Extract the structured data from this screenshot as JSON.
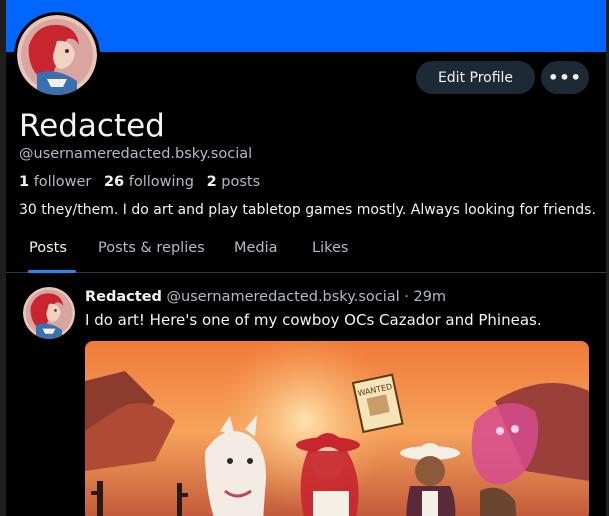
{
  "colors": {
    "banner": "#0066ff",
    "accent": "#208bfe",
    "background": "#000000",
    "text_primary": "#f1f3f5",
    "text_secondary": "#aebbc9",
    "button_bg": "#1e2936"
  },
  "profile": {
    "display_name": "Redacted",
    "handle": "@usernameredacted.bsky.social",
    "followers_count": "1",
    "followers_label": "follower",
    "following_count": "26",
    "following_label": "following",
    "posts_count": "2",
    "posts_label": "posts",
    "bio": "30 they/them.  I do art and play tabletop games mostly. Always looking for friends."
  },
  "header": {
    "edit_profile_label": "Edit Profile",
    "more_icon": "more-horizontal-icon"
  },
  "tabs": [
    {
      "label": "Posts",
      "active": true
    },
    {
      "label": "Posts & replies",
      "active": false
    },
    {
      "label": "Media",
      "active": false
    },
    {
      "label": "Likes",
      "active": false
    }
  ],
  "post": {
    "author": "Redacted",
    "handle": "@usernameredacted.bsky.social",
    "separator": "·",
    "time": "29m",
    "text": "I do art! Here's one of my cowboy OCs Cazador and Phineas.",
    "image_text": "WANTED"
  }
}
